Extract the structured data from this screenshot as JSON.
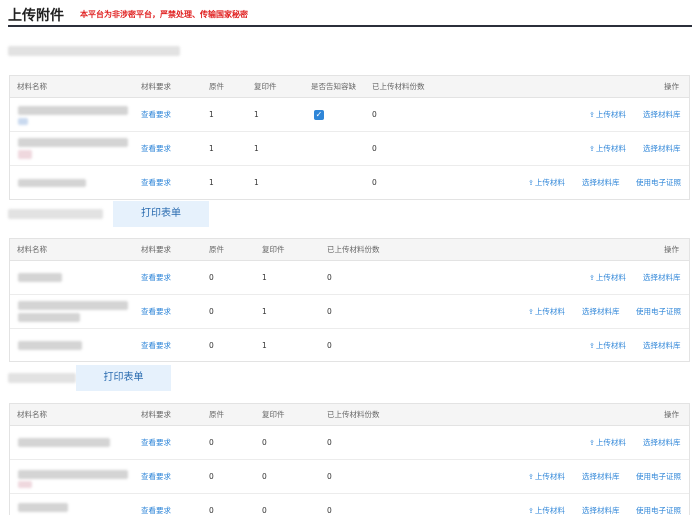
{
  "header": {
    "title": "上传附件",
    "warning": "本平台为非涉密平台，严禁处理、传输国家秘密"
  },
  "print_label": "打印表单",
  "columns": {
    "name": "材料名称",
    "req": "材料要求",
    "orig": "原件",
    "copy": "复印件",
    "notify": "是否告知容缺",
    "uploaded": "已上传材料份数",
    "ops": "操作"
  },
  "actions": {
    "view_req": "查看要求",
    "upload": "上传材料",
    "select_lib": "选择材料库",
    "e_cert": "使用电子证照",
    "upload_icon": "upload-icon",
    "check_icon": "check-icon"
  },
  "sections": [
    {
      "rows": [
        {
          "orig": "1",
          "copy": "1",
          "uploaded": "0",
          "notify_checked": true
        },
        {
          "orig": "1",
          "copy": "1",
          "uploaded": "0"
        },
        {
          "orig": "1",
          "copy": "1",
          "uploaded": "0"
        }
      ]
    },
    {
      "rows": [
        {
          "orig": "0",
          "copy": "1",
          "uploaded": "0"
        },
        {
          "orig": "0",
          "copy": "1",
          "uploaded": "0"
        },
        {
          "orig": "0",
          "copy": "1",
          "uploaded": "0"
        }
      ]
    },
    {
      "rows": [
        {
          "orig": "0",
          "copy": "0",
          "uploaded": "0"
        },
        {
          "orig": "0",
          "copy": "0",
          "uploaded": "0"
        },
        {
          "orig": "0",
          "copy": "0",
          "uploaded": "0"
        }
      ]
    }
  ]
}
